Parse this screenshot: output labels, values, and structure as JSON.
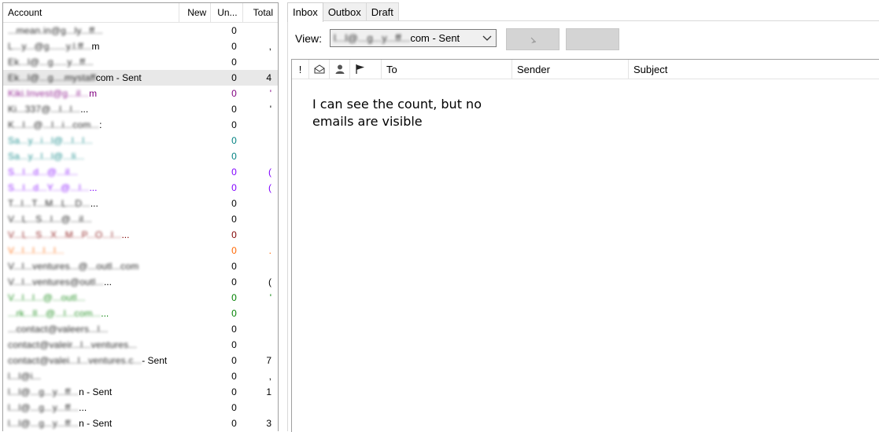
{
  "accounts_panel": {
    "headers": {
      "account": "Account",
      "new": "New",
      "unread": "Un...",
      "total": "Total"
    },
    "rows": [
      {
        "name": "...mean.in@g...ly...ff...",
        "suffix": "",
        "new": "",
        "unread": "0",
        "total": "",
        "color": "#000000",
        "selected": false
      },
      {
        "name": "L...y...@g......y.l.ff...",
        "suffix": "m",
        "new": "",
        "unread": "0",
        "total": ",",
        "color": "#000000",
        "selected": false
      },
      {
        "name": "Ek...l@...g.....y...ff...",
        "suffix": "",
        "new": "",
        "unread": "0",
        "total": "",
        "color": "#000000",
        "selected": false
      },
      {
        "name": "Ek...l@...g....mystaff",
        "suffix": "com - Sent",
        "new": "",
        "unread": "0",
        "total": "4",
        "color": "#000000",
        "selected": true
      },
      {
        "name": "Kiki.Invest@g...il...",
        "suffix": "m",
        "new": "",
        "unread": "0",
        "total": "'",
        "color": "#800080",
        "selected": false
      },
      {
        "name": "Ki...337@...l...l...",
        "suffix": "...",
        "new": "",
        "unread": "0",
        "total": "'",
        "color": "#000000",
        "selected": false
      },
      {
        "name": "K...l...@...l...i...com...",
        "suffix": ":",
        "new": "",
        "unread": "0",
        "total": "",
        "color": "#000000",
        "selected": false
      },
      {
        "name": "Sa...y...i...l@...l...l...",
        "suffix": "",
        "new": "",
        "unread": "0",
        "total": "",
        "color": "#008080",
        "selected": false
      },
      {
        "name": "Sa...y...l...l@...li...",
        "suffix": "",
        "new": "",
        "unread": "0",
        "total": "",
        "color": "#008080",
        "selected": false
      },
      {
        "name": "S...l...d...@...il...",
        "suffix": "",
        "new": "",
        "unread": "0",
        "total": "(",
        "color": "#8000ff",
        "selected": false
      },
      {
        "name": "S...l...d...Y...@...l...",
        "suffix": "...",
        "new": "",
        "unread": "0",
        "total": "(",
        "color": "#8000ff",
        "selected": false
      },
      {
        "name": "T...l...T...M...L...D...",
        "suffix": "...",
        "new": "",
        "unread": "0",
        "total": "",
        "color": "#000000",
        "selected": false
      },
      {
        "name": "V...L...S...l...@...il...",
        "suffix": "",
        "new": "",
        "unread": "0",
        "total": "",
        "color": "#000000",
        "selected": false
      },
      {
        "name": "V...L...S...X...M...P...O...l...",
        "suffix": "...",
        "new": "",
        "unread": "0",
        "total": "",
        "color": "#800000",
        "selected": false
      },
      {
        "name": "V...l...l...l...l...",
        "suffix": "",
        "new": "",
        "unread": "0",
        "total": ".",
        "color": "#ff6600",
        "selected": false
      },
      {
        "name": "V...l...ventures...@...outl...com",
        "suffix": "",
        "new": "",
        "unread": "0",
        "total": "",
        "color": "#000000",
        "selected": false
      },
      {
        "name": "V...l...ventures@outl...",
        "suffix": "...",
        "new": "",
        "unread": "0",
        "total": "(",
        "color": "#000000",
        "selected": false
      },
      {
        "name": "V...l...l...@...outl...",
        "suffix": "",
        "new": "",
        "unread": "0",
        "total": "'",
        "color": "#008000",
        "selected": false
      },
      {
        "name": "...rk...ll...@...l...com...",
        "suffix": "...",
        "new": "",
        "unread": "0",
        "total": "",
        "color": "#008000",
        "selected": false
      },
      {
        "name": "...contact@valeers...l...",
        "suffix": "",
        "new": "",
        "unread": "0",
        "total": "",
        "color": "#000000",
        "selected": false
      },
      {
        "name": "contact@valeir...l...ventures...",
        "suffix": "",
        "new": "",
        "unread": "0",
        "total": "",
        "color": "#000000",
        "selected": false
      },
      {
        "name": "contact@valei...l...ventures.c...",
        "suffix": " - Sent",
        "new": "",
        "unread": "0",
        "total": "7",
        "color": "#000000",
        "selected": false
      },
      {
        "name": "l...l@i...",
        "suffix": "",
        "new": "",
        "unread": "0",
        "total": ",",
        "color": "#000000",
        "selected": false
      },
      {
        "name": "l...l@...g...y...ff...",
        "suffix": "n - Sent",
        "new": "",
        "unread": "0",
        "total": "1",
        "color": "#000000",
        "selected": false
      },
      {
        "name": "l...l@...g...y...ff...",
        "suffix": "...",
        "new": "",
        "unread": "0",
        "total": "",
        "color": "#000000",
        "selected": false
      },
      {
        "name": "l...l@...g...y...ff...",
        "suffix": "n - Sent",
        "new": "",
        "unread": "0",
        "total": "3",
        "color": "#000000",
        "selected": false
      }
    ]
  },
  "tabs": [
    {
      "label": "Inbox",
      "active": true
    },
    {
      "label": "Outbox",
      "active": false
    },
    {
      "label": "Draft",
      "active": false
    }
  ],
  "view": {
    "label": "View:",
    "selected_blurred": "l...l@...g...y...ff...",
    "selected_suffix": "com - Sent"
  },
  "message_list": {
    "headers": {
      "importance": "!",
      "to": "To",
      "sender": "Sender",
      "subject": "Subject"
    },
    "icons": [
      "envelope-icon",
      "contact-icon",
      "flag-icon"
    ],
    "empty_text": "I can see the count, but no emails are visible"
  }
}
